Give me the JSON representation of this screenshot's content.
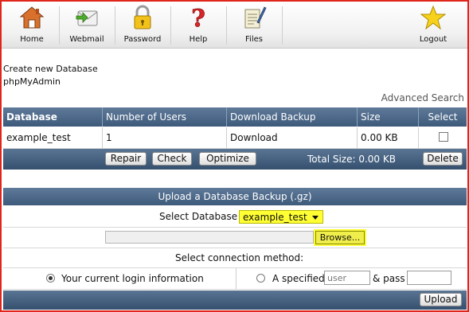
{
  "toolbar": {
    "home": "Home",
    "webmail": "Webmail",
    "password": "Password",
    "help": "Help",
    "files": "Files",
    "logout": "Logout"
  },
  "links": {
    "create_db": "Create new Database",
    "phpmyadmin": "phpMyAdmin",
    "advanced_search": "Advanced Search"
  },
  "table": {
    "headers": [
      "Database",
      "Number of Users",
      "Download Backup",
      "Size",
      "Select"
    ],
    "rows": [
      {
        "database": "example_test",
        "users": "1",
        "backup": "Download",
        "size": "0.00 KB",
        "selected": false
      }
    ]
  },
  "actions": {
    "repair": "Repair",
    "check": "Check",
    "optimize": "Optimize",
    "total_size": "Total Size: 0.00 KB",
    "delete": "Delete"
  },
  "upload": {
    "title": "Upload a Database Backup (.gz)",
    "select_label": "Select Database",
    "selected_db": "example_test",
    "browse": "Browse...",
    "method_label": "Select connection method:",
    "option_current": "Your current login information",
    "option_specified": "A specified",
    "user_placeholder": "user",
    "and_pass": "& pass",
    "upload_button": "Upload"
  },
  "colors": {
    "header_bar": "#3e5a7b",
    "highlight": "#ffff33",
    "frame": "#e0261c"
  }
}
